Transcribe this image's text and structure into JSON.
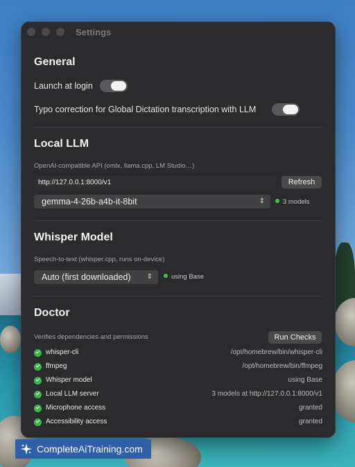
{
  "window": {
    "title": "Settings"
  },
  "general": {
    "heading": "General",
    "launch_at_login": {
      "label": "Launch at login",
      "on": true
    },
    "typo_correction": {
      "label": "Typo correction for Global Dictation transcription with LLM",
      "on": true
    }
  },
  "local_llm": {
    "heading": "Local LLM",
    "api_label": "OpenAI-compatible API (omlx, llama.cpp, LM Studio…)",
    "api_url": "http://127.0.0.1:8000/v1",
    "refresh_label": "Refresh",
    "model_selected": "gemma-4-26b-a4b-it-8bit",
    "models_status": "3 models"
  },
  "whisper": {
    "heading": "Whisper Model",
    "subtitle": "Speech-to-text (whisper.cpp, runs on-device)",
    "model_selected": "Auto (first downloaded)",
    "status": "using Base"
  },
  "doctor": {
    "heading": "Doctor",
    "subtitle": "Verifies dependencies and permissions",
    "run_checks_label": "Run Checks",
    "checks": [
      {
        "name": "whisper-cli",
        "value": "/opt/homebrew/bin/whisper-cli"
      },
      {
        "name": "ffmpeg",
        "value": "/opt/homebrew/bin/ffmpeg"
      },
      {
        "name": "Whisper model",
        "value": "using Base"
      },
      {
        "name": "Local LLM server",
        "value": "3 models at http://127.0.0.1:8000/v1"
      },
      {
        "name": "Microphone access",
        "value": "granted"
      },
      {
        "name": "Accessibility access",
        "value": "granted"
      }
    ]
  },
  "watermark": {
    "text": "CompleteAiTraining.com"
  },
  "colors": {
    "status_green": "#3ec15a",
    "check_green": "#3ab54a",
    "window_bg": "#2b2b2d"
  }
}
